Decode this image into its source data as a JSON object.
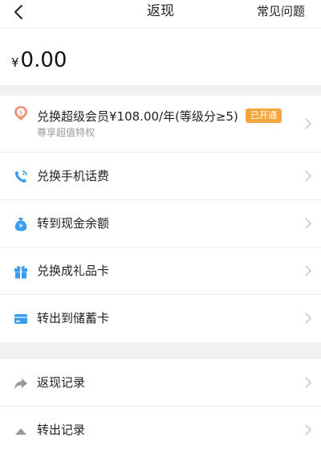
{
  "header": {
    "title": "返现",
    "faq_label": "常见问题"
  },
  "balance": {
    "currency": "¥",
    "amount": "0.00"
  },
  "menu": [
    {
      "label": "兑换超级会员¥108.00/年(等级分≥5)",
      "sub": "尊享超值特权",
      "badge": "已开通",
      "icon": "super-vip-coin-icon"
    },
    {
      "label": "兑换手机话费",
      "icon": "phone-call-icon"
    },
    {
      "label": "转到现金余额",
      "icon": "money-bag-icon"
    },
    {
      "label": "兑换成礼品卡",
      "icon": "gift-icon"
    },
    {
      "label": "转出到储蓄卡",
      "icon": "bank-card-icon"
    }
  ],
  "records": [
    {
      "label": "返现记录",
      "icon": "share-arrow-icon"
    },
    {
      "label": "转出记录",
      "icon": "transfer-out-icon"
    }
  ],
  "colors": {
    "accent_blue": "#3a9bef",
    "badge_orange": "#f3a640",
    "coin_orange": "#e9967a"
  }
}
